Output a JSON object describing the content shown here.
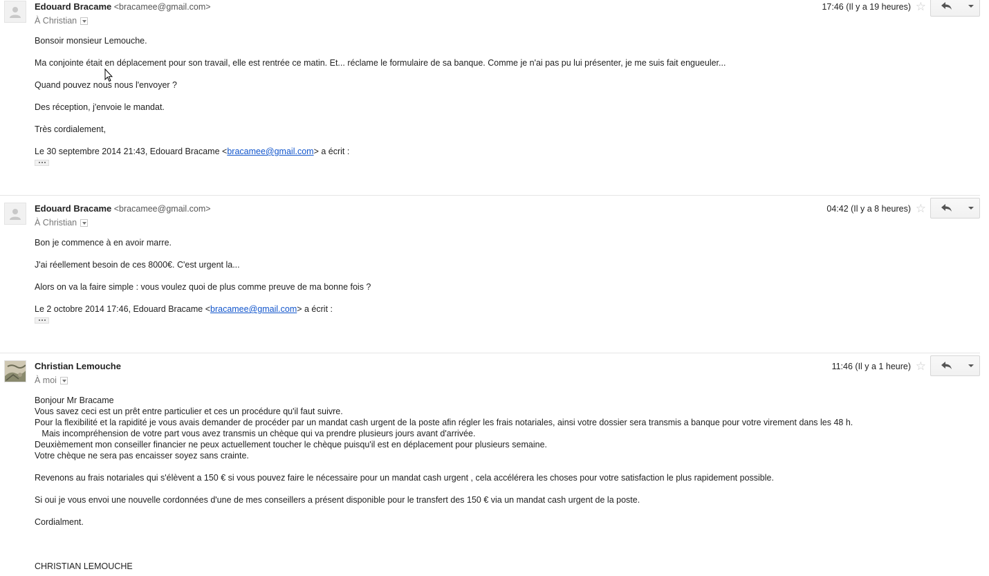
{
  "colors": {
    "link": "#1155cc",
    "text": "#222222",
    "muted": "#777777",
    "divider": "#e5e5e5"
  },
  "messages": [
    {
      "sender_name": "Edouard Bracame",
      "sender_email": "<bracamee@gmail.com>",
      "recipient": "À Christian",
      "time": "17:46 (Il y a 19 heures)",
      "avatar_icon": "default-person-icon",
      "paragraphs": [
        "Bonsoir monsieur Lemouche.",
        "Ma conjointe était en déplacement pour son travail, elle est rentrée ce matin. Et... réclame le formulaire de sa banque. Comme je n'ai pas pu lui présenter, je me suis fait engueuler...",
        "Quand pouvez nous nous l'envoyer ?",
        "Des réception, j'envoie le mandat.",
        "Très cordialement,"
      ],
      "quote_prefix": "Le 30 septembre 2014 21:43, Edouard Bracame <",
      "quote_link": "bracamee@gmail.com",
      "quote_suffix": "> a écrit :"
    },
    {
      "sender_name": "Edouard Bracame",
      "sender_email": "<bracamee@gmail.com>",
      "recipient": "À Christian",
      "time": "04:42 (Il y a 8 heures)",
      "avatar_icon": "default-person-icon",
      "paragraphs": [
        "Bon je commence à en avoir marre.",
        "J'ai réellement besoin de ces 8000€. C'est urgent la...",
        "Alors on va la faire simple : vous voulez quoi de plus comme preuve de ma bonne fois ?"
      ],
      "quote_prefix": "Le 2 octobre 2014 17:46, Edouard Bracame <",
      "quote_link": "bracamee@gmail.com",
      "quote_suffix": "> a écrit :"
    },
    {
      "sender_name": "Christian Lemouche",
      "recipient": "À moi",
      "time": "11:46 (Il y a 1 heure)",
      "avatar_icon": "photo-avatar",
      "lines": [
        "Bonjour Mr Bracame",
        "Vous savez ceci est un prêt entre particulier et ces un procédure qu'il faut suivre.",
        "Pour la flexibilité et la rapidité je vous avais demander de procéder par un mandat cash urgent de la poste afin régler les frais notariales, ainsi votre dossier sera transmis a banque pour votre virement dans les 48 h.",
        "   Mais incompréhension de votre part vous avez transmis un chèque qui va prendre plusieurs jours avant d'arrivée.",
        "Deuxièmement mon conseiller financier ne peux actuellement toucher le chèque puisqu'il est en déplacement pour plusieurs semaine.",
        "Votre chèque ne sera pas encaisser soyez sans crainte.",
        "",
        "Revenons au frais notariales qui s'élèvent a 150 € si vous pouvez faire le nécessaire pour un mandat cash urgent , cela accélérera les choses pour votre satisfaction le plus rapidement possible.",
        "",
        "Si oui je vous envoi une nouvelle cordonnées d'une de mes conseillers a présent disponible pour le transfert des 150 € via un mandat cash urgent de la poste.",
        "",
        "Cordialment.",
        "",
        "",
        "",
        "CHRISTIAN LEMOUCHE"
      ]
    }
  ]
}
